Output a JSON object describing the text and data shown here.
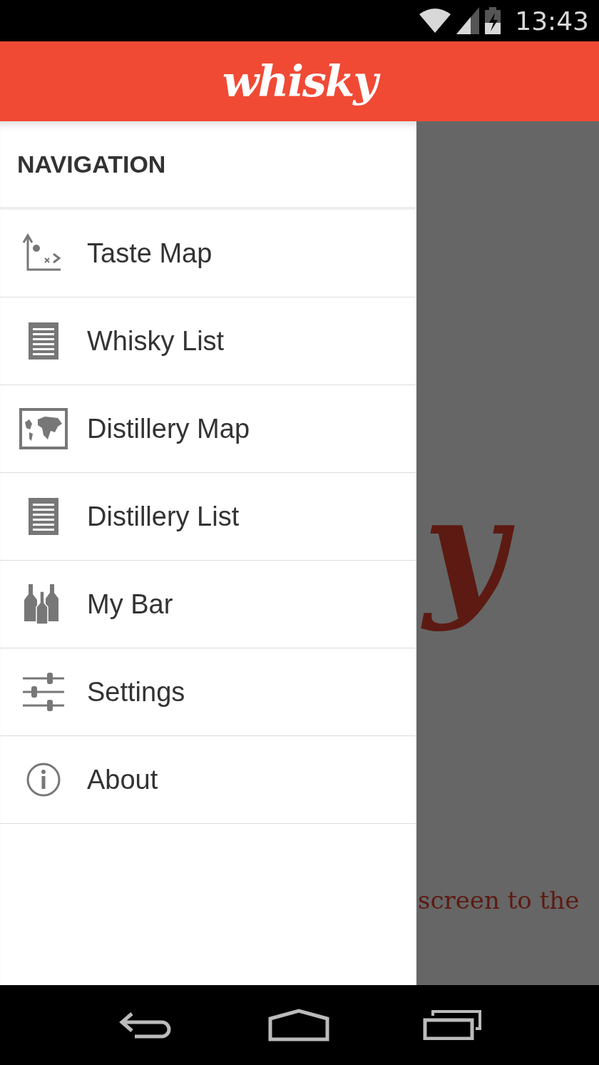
{
  "status_bar": {
    "time": "13:43"
  },
  "app_bar": {
    "logo": "whisky"
  },
  "drawer": {
    "header": "NAVIGATION",
    "items": [
      {
        "label": "Taste Map"
      },
      {
        "label": "Whisky List"
      },
      {
        "label": "Distillery Map"
      },
      {
        "label": "Distillery List"
      },
      {
        "label": "My Bar"
      },
      {
        "label": "Settings"
      },
      {
        "label": "About"
      }
    ]
  },
  "background": {
    "logo_fragment": "y",
    "hint_fragment": "screen to the"
  }
}
